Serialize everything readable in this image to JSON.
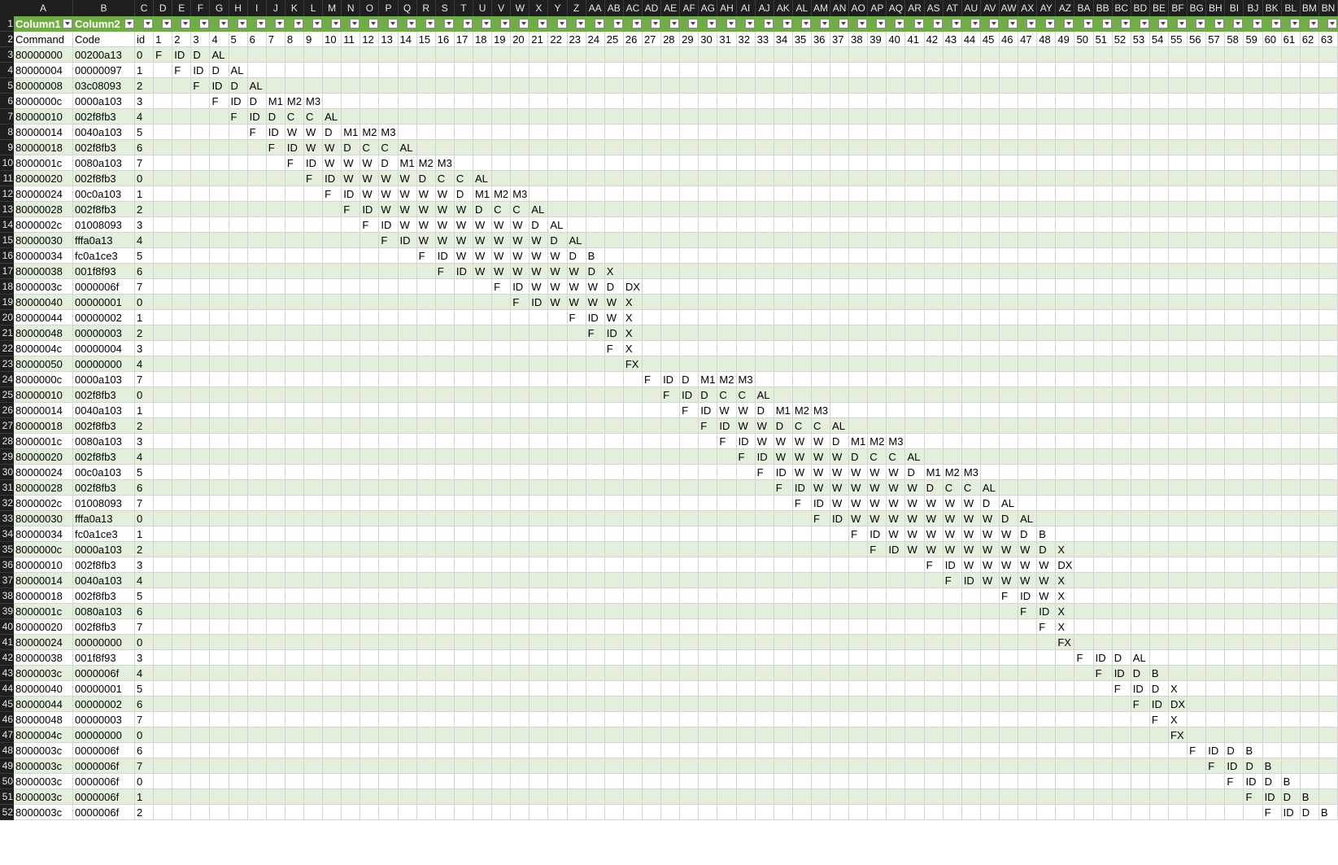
{
  "columns": [
    "A",
    "B",
    "C",
    "D",
    "E",
    "F",
    "G",
    "H",
    "I",
    "J",
    "K",
    "L",
    "M",
    "N",
    "O",
    "P",
    "Q",
    "R",
    "S",
    "T",
    "U",
    "V",
    "W",
    "X",
    "Y",
    "Z",
    "AA",
    "AB",
    "AC",
    "AD",
    "AE",
    "AF",
    "AG",
    "AH",
    "AI",
    "AJ",
    "AK",
    "AL",
    "AM",
    "AN",
    "AO",
    "AP",
    "AQ",
    "AR",
    "AS",
    "AT",
    "AU",
    "AV",
    "AW",
    "AX",
    "AY",
    "AZ",
    "BA",
    "BB",
    "BC",
    "BD",
    "BE",
    "BF",
    "BG",
    "BH",
    "BI",
    "BJ",
    "BK",
    "BL",
    "BM",
    "BN"
  ],
  "table_header": {
    "col_a": "Column1",
    "col_b": "Column2"
  },
  "header_row": [
    "Command",
    "Code",
    "id",
    "1",
    "2",
    "3",
    "4",
    "5",
    "6",
    "7",
    "8",
    "9",
    "10",
    "11",
    "12",
    "13",
    "14",
    "15",
    "16",
    "17",
    "18",
    "19",
    "20",
    "21",
    "22",
    "23",
    "24",
    "25",
    "26",
    "27",
    "28",
    "29",
    "30",
    "31",
    "32",
    "33",
    "34",
    "35",
    "36",
    "37",
    "38",
    "39",
    "40",
    "41",
    "42",
    "43",
    "44",
    "45",
    "46",
    "47",
    "48",
    "49",
    "50",
    "51",
    "52",
    "53",
    "54",
    "55",
    "56",
    "57",
    "58",
    "59",
    "60",
    "61",
    "62",
    "63"
  ],
  "rows": [
    {
      "num": "3",
      "command": "80000000",
      "code": "00200a13",
      "id": "0",
      "start": 1,
      "stages": [
        "F",
        "ID",
        "D",
        "AL"
      ]
    },
    {
      "num": "4",
      "command": "80000004",
      "code": "00000097",
      "id": "1",
      "start": 2,
      "stages": [
        "F",
        "ID",
        "D",
        "AL"
      ]
    },
    {
      "num": "5",
      "command": "80000008",
      "code": "03c08093",
      "id": "2",
      "start": 3,
      "stages": [
        "F",
        "ID",
        "D",
        "AL"
      ]
    },
    {
      "num": "6",
      "command": "8000000c",
      "code": "0000a103",
      "id": "3",
      "start": 4,
      "stages": [
        "F",
        "ID",
        "D",
        "M1",
        "M2",
        "M3"
      ]
    },
    {
      "num": "7",
      "command": "80000010",
      "code": "002f8fb3",
      "id": "4",
      "start": 5,
      "stages": [
        "F",
        "ID",
        "D",
        "C",
        "C",
        "AL"
      ]
    },
    {
      "num": "8",
      "command": "80000014",
      "code": "0040a103",
      "id": "5",
      "start": 6,
      "stages": [
        "F",
        "ID",
        "W",
        "W",
        "D",
        "M1",
        "M2",
        "M3"
      ]
    },
    {
      "num": "9",
      "command": "80000018",
      "code": "002f8fb3",
      "id": "6",
      "start": 7,
      "stages": [
        "F",
        "ID",
        "W",
        "W",
        "D",
        "C",
        "C",
        "AL"
      ]
    },
    {
      "num": "10",
      "command": "8000001c",
      "code": "0080a103",
      "id": "7",
      "start": 8,
      "stages": [
        "F",
        "ID",
        "W",
        "W",
        "W",
        "D",
        "M1",
        "M2",
        "M3"
      ]
    },
    {
      "num": "11",
      "command": "80000020",
      "code": "002f8fb3",
      "id": "0",
      "start": 9,
      "stages": [
        "F",
        "ID",
        "W",
        "W",
        "W",
        "W",
        "D",
        "C",
        "C",
        "AL"
      ]
    },
    {
      "num": "12",
      "command": "80000024",
      "code": "00c0a103",
      "id": "1",
      "start": 10,
      "stages": [
        "F",
        "ID",
        "W",
        "W",
        "W",
        "W",
        "W",
        "D",
        "M1",
        "M2",
        "M3"
      ]
    },
    {
      "num": "13",
      "command": "80000028",
      "code": "002f8fb3",
      "id": "2",
      "start": 11,
      "stages": [
        "F",
        "ID",
        "W",
        "W",
        "W",
        "W",
        "W",
        "D",
        "C",
        "C",
        "AL"
      ]
    },
    {
      "num": "14",
      "command": "8000002c",
      "code": "01008093",
      "id": "3",
      "start": 12,
      "stages": [
        "F",
        "ID",
        "W",
        "W",
        "W",
        "W",
        "W",
        "W",
        "W",
        "D",
        "AL"
      ]
    },
    {
      "num": "15",
      "command": "80000030",
      "code": "fffa0a13",
      "id": "4",
      "start": 13,
      "stages": [
        "F",
        "ID",
        "W",
        "W",
        "W",
        "W",
        "W",
        "W",
        "W",
        "D",
        "AL"
      ]
    },
    {
      "num": "16",
      "command": "80000034",
      "code": "fc0a1ce3",
      "id": "5",
      "start": 15,
      "stages": [
        "F",
        "ID",
        "W",
        "W",
        "W",
        "W",
        "W",
        "W",
        "D",
        "B"
      ]
    },
    {
      "num": "17",
      "command": "80000038",
      "code": "001f8f93",
      "id": "6",
      "start": 16,
      "stages": [
        "F",
        "ID",
        "W",
        "W",
        "W",
        "W",
        "W",
        "W",
        "D",
        "X"
      ]
    },
    {
      "num": "18",
      "command": "8000003c",
      "code": "0000006f",
      "id": "7",
      "start": 19,
      "stages": [
        "F",
        "ID",
        "W",
        "W",
        "W",
        "W",
        "D",
        "DX"
      ]
    },
    {
      "num": "19",
      "command": "80000040",
      "code": "00000001",
      "id": "0",
      "start": 20,
      "stages": [
        "F",
        "ID",
        "W",
        "W",
        "W",
        "W",
        "X"
      ]
    },
    {
      "num": "20",
      "command": "80000044",
      "code": "00000002",
      "id": "1",
      "start": 23,
      "stages": [
        "F",
        "ID",
        "W",
        "X"
      ]
    },
    {
      "num": "21",
      "command": "80000048",
      "code": "00000003",
      "id": "2",
      "start": 24,
      "stages": [
        "F",
        "ID",
        "X"
      ]
    },
    {
      "num": "22",
      "command": "8000004c",
      "code": "00000004",
      "id": "3",
      "start": 25,
      "stages": [
        "F",
        "X"
      ]
    },
    {
      "num": "23",
      "command": "80000050",
      "code": "00000000",
      "id": "4",
      "start": 26,
      "stages": [
        "FX"
      ]
    },
    {
      "num": "24",
      "command": "8000000c",
      "code": "0000a103",
      "id": "7",
      "start": 27,
      "stages": [
        "F",
        "ID",
        "D",
        "M1",
        "M2",
        "M3"
      ]
    },
    {
      "num": "25",
      "command": "80000010",
      "code": "002f8fb3",
      "id": "0",
      "start": 28,
      "stages": [
        "F",
        "ID",
        "D",
        "C",
        "C",
        "AL"
      ]
    },
    {
      "num": "26",
      "command": "80000014",
      "code": "0040a103",
      "id": "1",
      "start": 29,
      "stages": [
        "F",
        "ID",
        "W",
        "W",
        "D",
        "M1",
        "M2",
        "M3"
      ]
    },
    {
      "num": "27",
      "command": "80000018",
      "code": "002f8fb3",
      "id": "2",
      "start": 30,
      "stages": [
        "F",
        "ID",
        "W",
        "W",
        "D",
        "C",
        "C",
        "AL"
      ]
    },
    {
      "num": "28",
      "command": "8000001c",
      "code": "0080a103",
      "id": "3",
      "start": 31,
      "stages": [
        "F",
        "ID",
        "W",
        "W",
        "W",
        "W",
        "D",
        "M1",
        "M2",
        "M3"
      ]
    },
    {
      "num": "29",
      "command": "80000020",
      "code": "002f8fb3",
      "id": "4",
      "start": 32,
      "stages": [
        "F",
        "ID",
        "W",
        "W",
        "W",
        "W",
        "D",
        "C",
        "C",
        "AL"
      ]
    },
    {
      "num": "30",
      "command": "80000024",
      "code": "00c0a103",
      "id": "5",
      "start": 33,
      "stages": [
        "F",
        "ID",
        "W",
        "W",
        "W",
        "W",
        "W",
        "W",
        "D",
        "M1",
        "M2",
        "M3"
      ]
    },
    {
      "num": "31",
      "command": "80000028",
      "code": "002f8fb3",
      "id": "6",
      "start": 34,
      "stages": [
        "F",
        "ID",
        "W",
        "W",
        "W",
        "W",
        "W",
        "W",
        "D",
        "C",
        "C",
        "AL"
      ]
    },
    {
      "num": "32",
      "command": "8000002c",
      "code": "01008093",
      "id": "7",
      "start": 35,
      "stages": [
        "F",
        "ID",
        "W",
        "W",
        "W",
        "W",
        "W",
        "W",
        "W",
        "W",
        "D",
        "AL"
      ]
    },
    {
      "num": "33",
      "command": "80000030",
      "code": "fffa0a13",
      "id": "0",
      "start": 36,
      "stages": [
        "F",
        "ID",
        "W",
        "W",
        "W",
        "W",
        "W",
        "W",
        "W",
        "W",
        "D",
        "AL"
      ]
    },
    {
      "num": "34",
      "command": "80000034",
      "code": "fc0a1ce3",
      "id": "1",
      "start": 38,
      "stages": [
        "F",
        "ID",
        "W",
        "W",
        "W",
        "W",
        "W",
        "W",
        "W",
        "D",
        "B"
      ]
    },
    {
      "num": "35",
      "command": "8000000c",
      "code": "0000a103",
      "id": "2",
      "start": 39,
      "stages": [
        "F",
        "ID",
        "W",
        "W",
        "W",
        "W",
        "W",
        "W",
        "W",
        "D",
        "X"
      ]
    },
    {
      "num": "36",
      "command": "80000010",
      "code": "002f8fb3",
      "id": "3",
      "start": 42,
      "stages": [
        "F",
        "ID",
        "W",
        "W",
        "W",
        "W",
        "W",
        "DX"
      ]
    },
    {
      "num": "37",
      "command": "80000014",
      "code": "0040a103",
      "id": "4",
      "start": 43,
      "stages": [
        "F",
        "ID",
        "W",
        "W",
        "W",
        "W",
        "X"
      ]
    },
    {
      "num": "38",
      "command": "80000018",
      "code": "002f8fb3",
      "id": "5",
      "start": 46,
      "stages": [
        "F",
        "ID",
        "W",
        "X"
      ]
    },
    {
      "num": "39",
      "command": "8000001c",
      "code": "0080a103",
      "id": "6",
      "start": 47,
      "stages": [
        "F",
        "ID",
        "X"
      ]
    },
    {
      "num": "40",
      "command": "80000020",
      "code": "002f8fb3",
      "id": "7",
      "start": 48,
      "stages": [
        "F",
        "X"
      ]
    },
    {
      "num": "41",
      "command": "80000024",
      "code": "00000000",
      "id": "0",
      "start": 49,
      "stages": [
        "FX"
      ]
    },
    {
      "num": "42",
      "command": "80000038",
      "code": "001f8f93",
      "id": "3",
      "start": 50,
      "stages": [
        "F",
        "ID",
        "D",
        "AL"
      ]
    },
    {
      "num": "43",
      "command": "8000003c",
      "code": "0000006f",
      "id": "4",
      "start": 51,
      "stages": [
        "F",
        "ID",
        "D",
        "B"
      ]
    },
    {
      "num": "44",
      "command": "80000040",
      "code": "00000001",
      "id": "5",
      "start": 52,
      "stages": [
        "F",
        "ID",
        "D",
        "X"
      ]
    },
    {
      "num": "45",
      "command": "80000044",
      "code": "00000002",
      "id": "6",
      "start": 53,
      "stages": [
        "F",
        "ID",
        "DX"
      ]
    },
    {
      "num": "46",
      "command": "80000048",
      "code": "00000003",
      "id": "7",
      "start": 54,
      "stages": [
        "F",
        "X"
      ]
    },
    {
      "num": "47",
      "command": "8000004c",
      "code": "00000000",
      "id": "0",
      "start": 55,
      "stages": [
        "FX"
      ]
    },
    {
      "num": "48",
      "command": "8000003c",
      "code": "0000006f",
      "id": "6",
      "start": 56,
      "stages": [
        "F",
        "ID",
        "D",
        "B"
      ]
    },
    {
      "num": "49",
      "command": "8000003c",
      "code": "0000006f",
      "id": "7",
      "start": 57,
      "stages": [
        "F",
        "ID",
        "D",
        "B"
      ]
    },
    {
      "num": "50",
      "command": "8000003c",
      "code": "0000006f",
      "id": "0",
      "start": 58,
      "stages": [
        "F",
        "ID",
        "D",
        "B"
      ]
    },
    {
      "num": "51",
      "command": "8000003c",
      "code": "0000006f",
      "id": "1",
      "start": 59,
      "stages": [
        "F",
        "ID",
        "D",
        "B"
      ]
    },
    {
      "num": "52",
      "command": "8000003c",
      "code": "0000006f",
      "id": "2",
      "start": 60,
      "stages": [
        "F",
        "ID",
        "D",
        "B"
      ]
    }
  ]
}
